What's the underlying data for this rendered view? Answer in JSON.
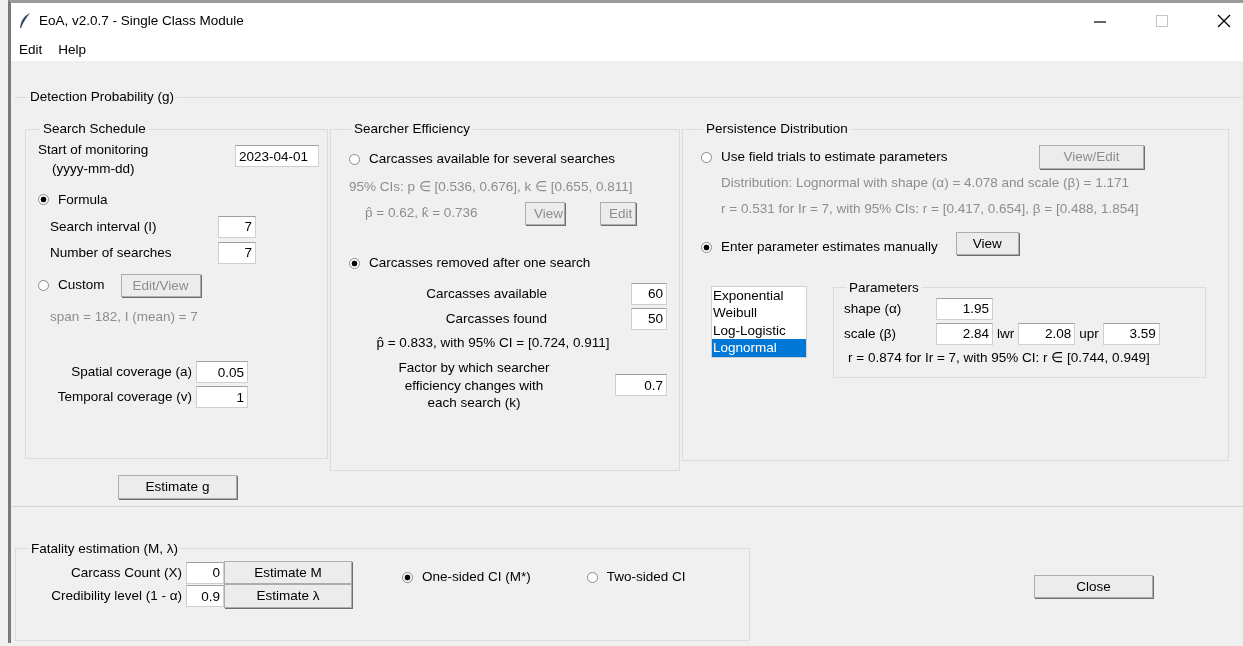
{
  "window": {
    "title": "EoA, v2.0.7 - Single Class Module"
  },
  "menu": [
    {
      "label": "Edit"
    },
    {
      "label": "Help"
    }
  ],
  "detection_probability": {
    "title": "Detection Probability (g)",
    "search_schedule": {
      "title": "Search Schedule",
      "start_label": [
        "Start of monitoring",
        "(yyyy-mm-dd)"
      ],
      "start_value": "2023-04-01",
      "options": [
        {
          "label": "Formula",
          "selected": true
        },
        {
          "label": "Custom",
          "selected": false
        }
      ],
      "formula_fields": [
        {
          "label": "Search interval (I)",
          "value": "7"
        },
        {
          "label": "Number of searches",
          "value": "7"
        }
      ],
      "custom_button": {
        "label": "Edit/View",
        "disabled": true
      },
      "custom_summary": {
        "text": "span = 182, I (mean) = 7",
        "disabled": true
      },
      "coverage_fields": [
        {
          "label": "Spatial coverage (a)",
          "value": "0.05"
        },
        {
          "label": "Temporal coverage (v)",
          "value": "1"
        }
      ]
    },
    "searcher_efficiency": {
      "title": "Searcher Efficiency",
      "options": [
        {
          "label": "Carcasses available for several searches",
          "selected": false
        },
        {
          "label": "Carcasses removed after one search",
          "selected": true
        }
      ],
      "several": {
        "disabled": true,
        "ci_text": "95% CIs: p ∈ [0.536, 0.676], k ∈ [0.655, 0.811]",
        "estimate_text": "p̂ = 0.62, k̂ = 0.736",
        "buttons": [
          {
            "label": "View"
          },
          {
            "label": "Edit"
          }
        ]
      },
      "one_search": {
        "fields": [
          {
            "label": "Carcasses available",
            "value": "60"
          },
          {
            "label": "Carcasses found",
            "value": "50"
          }
        ],
        "result": "p̂ = 0.833, with 95% CI = [0.724, 0.911]",
        "factor_label": [
          "Factor by which searcher",
          "efficiency changes with",
          "each search (k)"
        ],
        "factor_value": "0.7"
      }
    },
    "persistence": {
      "title": "Persistence Distribution",
      "options": [
        {
          "label": "Use field trials to estimate parameters",
          "selected": false
        },
        {
          "label": "Enter parameter estimates manually",
          "selected": true
        }
      ],
      "field_trials": {
        "disabled": true,
        "button": "View/Edit",
        "lines": [
          "Distribution: Lognormal with shape (α) = 4.078 and scale (β) = 1.171",
          "r = 0.531 for Ir = 7, with 95% CIs: r = [0.417, 0.654], β = [0.488, 1.854]"
        ]
      },
      "manual_button": "View",
      "distributions": [
        {
          "label": "Exponential",
          "selected": false
        },
        {
          "label": "Weibull",
          "selected": false
        },
        {
          "label": "Log-Logistic",
          "selected": false
        },
        {
          "label": "Lognormal",
          "selected": true
        }
      ],
      "parameters": {
        "title": "Parameters",
        "shape_label": "shape (α)",
        "shape_value": "1.95",
        "scale_label": "scale (β)",
        "scale_value": "2.84",
        "lwr_label": "lwr",
        "lwr_value": "2.08",
        "upr_label": "upr",
        "upr_value": "3.59",
        "result": "r = 0.874 for Ir = 7, with 95% CI: r ∈ [0.744, 0.949]"
      }
    },
    "estimate_button": "Estimate g"
  },
  "fatality": {
    "title": "Fatality estimation (M, λ)",
    "fields": [
      {
        "label": "Carcass Count (X)",
        "value": "0",
        "button": "Estimate M"
      },
      {
        "label": "Credibility level (1 - α)",
        "value": "0.9",
        "button": "Estimate λ"
      }
    ],
    "ci_options": [
      {
        "label": "One-sided CI (M*)",
        "selected": true
      },
      {
        "label": "Two-sided CI",
        "selected": false
      }
    ]
  },
  "close_button": "Close"
}
